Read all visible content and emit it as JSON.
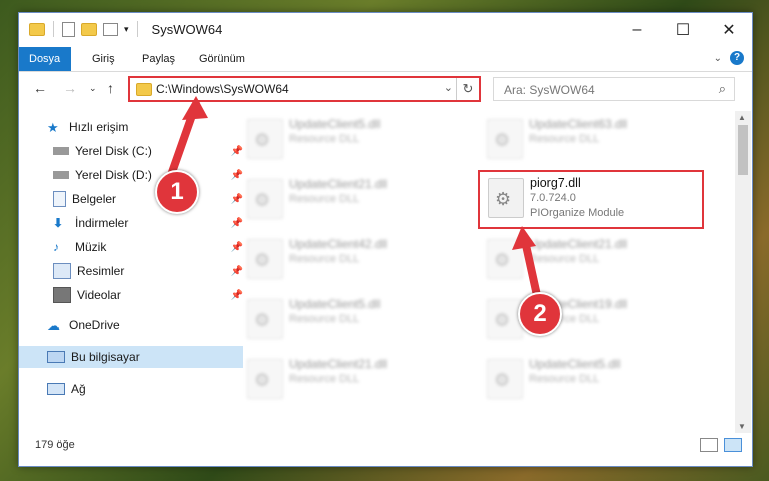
{
  "window": {
    "title": "SysWOW64"
  },
  "ribbon": {
    "tabs": [
      "Dosya",
      "Giriş",
      "Paylaş",
      "Görünüm"
    ]
  },
  "address": {
    "path": "C:\\Windows\\SysWOW64"
  },
  "search": {
    "placeholder": "Ara: SysWOW64"
  },
  "sidebar": {
    "items": [
      {
        "label": "Hızlı erişim",
        "icon": "star-icon"
      },
      {
        "label": "Yerel Disk (C:)",
        "icon": "drive-icon"
      },
      {
        "label": "Yerel Disk (D:)",
        "icon": "drive-icon"
      },
      {
        "label": "Belgeler",
        "icon": "documents-icon"
      },
      {
        "label": "İndirmeler",
        "icon": "download-icon"
      },
      {
        "label": "Müzik",
        "icon": "music-icon"
      },
      {
        "label": "Resimler",
        "icon": "pictures-icon"
      },
      {
        "label": "Videolar",
        "icon": "videos-icon"
      },
      {
        "label": "OneDrive",
        "icon": "cloud-icon"
      },
      {
        "label": "Bu bilgisayar",
        "icon": "computer-icon"
      },
      {
        "label": "Ağ",
        "icon": "network-icon"
      }
    ]
  },
  "files": [
    {
      "name": "UpdateClient5.dll",
      "desc": "Resource DLL"
    },
    {
      "name": "UpdateClient63.dll",
      "desc": "Resource DLL"
    },
    {
      "name": "UpdateClient21.dll",
      "desc": "Resource DLL"
    },
    {
      "name": "piorg7.dll",
      "version": "7.0.724.0",
      "desc": "PIOrganize Module"
    },
    {
      "name": "UpdateClient42.dll",
      "desc": "Resource DLL"
    },
    {
      "name": "UpdateClient21.dll",
      "desc": "Resource DLL"
    },
    {
      "name": "UpdateClient5.dll",
      "desc": "Resource DLL"
    },
    {
      "name": "UpdateClient19.dll",
      "desc": "Resource DLL"
    },
    {
      "name": "UpdateClient21.dll",
      "desc": "Resource DLL"
    },
    {
      "name": "UpdateClient5.dll",
      "desc": "Resource DLL"
    }
  ],
  "status": {
    "count": "179 öğe"
  },
  "annotations": {
    "step1": "1",
    "step2": "2"
  },
  "colors": {
    "accent": "#1979ca",
    "highlight": "#e0353b"
  }
}
